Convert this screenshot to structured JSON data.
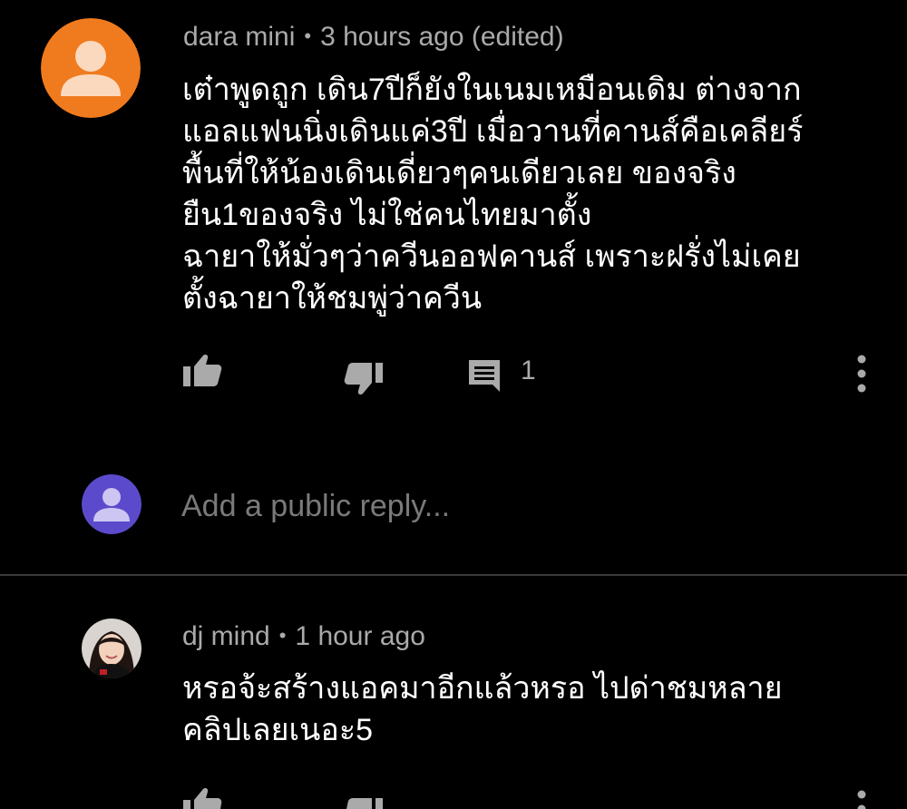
{
  "comments": [
    {
      "author": "dara mini",
      "separator": "•",
      "time": "3 hours ago (edited)",
      "avatar": "default-user-avatar",
      "avatar_color": "#f07b1e",
      "lines": [
        "เต๋าพูดถูก เดิน7ปีก็ยังในเนมเหมือนเดิม ต่างจาก",
        "แอลแฟนนิ่งเดินแค่3ปี เมื่อวานที่คานส์คือเคลียร์",
        "พื้นที่ให้น้องเดินเดี่ยวๆคนเดียวเลย ของจริง",
        "ยืน1ของจริง ไม่ใช่คนไทยมาตั้ง",
        "ฉายาให้มั่วๆว่าควีนออฟคานส์ เพราะฝรั่งไม่เคย",
        "ตั้งฉายาให้ชมพู่ว่าควีน"
      ],
      "reply_count": "1",
      "icons": {
        "like": "thumbs-up-icon",
        "dislike": "thumbs-down-icon",
        "reply": "comment-icon",
        "more": "more-vertical-icon"
      }
    },
    {
      "author": "dj mind",
      "separator": "•",
      "time": "1 hour ago",
      "avatar": "profile-photo",
      "lines": [
        "หรอจ้ะสร้างแอคมาอีกแล้วหรอ ไปด่าชมหลาย",
        "คลิปเลยเนอะ5"
      ]
    }
  ],
  "reply_input": {
    "placeholder": "Add a public reply...",
    "avatar": "default-user-avatar",
    "avatar_color": "#5b4bcc"
  },
  "colors": {
    "background": "#000000",
    "secondary_text": "#aaaaaa",
    "primary_text": "#ffffff"
  }
}
